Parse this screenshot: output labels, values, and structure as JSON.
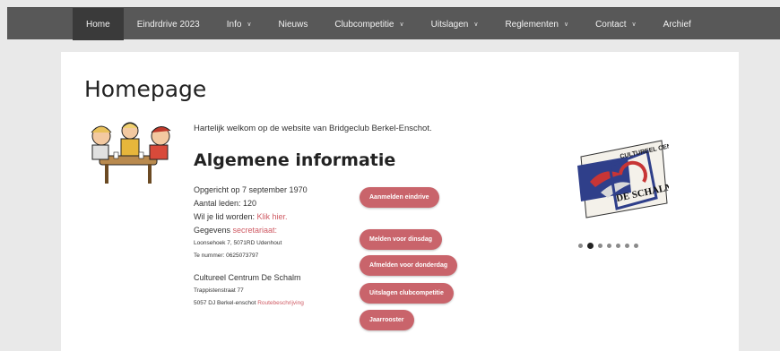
{
  "nav": {
    "items": [
      {
        "label": "Home",
        "dropdown": false,
        "active": true
      },
      {
        "label": "Eindrdrive 2023",
        "dropdown": false,
        "active": false
      },
      {
        "label": "Info",
        "dropdown": true,
        "active": false
      },
      {
        "label": "Nieuws",
        "dropdown": false,
        "active": false
      },
      {
        "label": "Clubcompetitie",
        "dropdown": true,
        "active": false
      },
      {
        "label": "Uitslagen",
        "dropdown": true,
        "active": false
      },
      {
        "label": "Reglementen",
        "dropdown": true,
        "active": false
      },
      {
        "label": "Contact",
        "dropdown": true,
        "active": false
      },
      {
        "label": "Archief",
        "dropdown": false,
        "active": false
      }
    ],
    "caret_glyph": "∨"
  },
  "page": {
    "title": "Homepage",
    "welcome": "Hartelijk welkom op de website van Bridgeclub Berkel-Enschot.",
    "section_title": "Algemene informatie"
  },
  "info": {
    "founded": "Opgericht op 7 september 1970",
    "members": "Aantal leden: 120",
    "join_prefix": "Wil je lid worden: ",
    "join_link": "Klik hier.",
    "contact_prefix": "Gegevens ",
    "contact_link": "secretariaat:",
    "address": "Loonsehoek 7, 5071RD Udenhout",
    "phone": "Te nummer: 0625073797",
    "venue_name": "Cultureel Centrum De Schalm",
    "venue_street": "Trappistenstraat 77",
    "venue_city": "5057 DJ Berkel-enschot ",
    "venue_link": "Routebeschrijving"
  },
  "buttons": {
    "eindrive": "Aanmelden eindrive",
    "melden_dinsdag": "Melden voor dinsdag",
    "afmelden_donderdag": "Afmelden voor donderdag",
    "uitslagen": "Uitslagen clubcompetitie",
    "jaarrooster": "Jaarrooster"
  },
  "logo": {
    "top_text": "CULTUREEL CENTRUM",
    "main_text": "DE SCHALM",
    "icon": "de-schalm-logo"
  },
  "carousel": {
    "count": 7,
    "active_index": 1
  },
  "colors": {
    "nav_bg": "#585858",
    "nav_active": "#3a3a3a",
    "accent": "#c9646b",
    "link": "#cf5a63",
    "page_bg": "#e9e9e9"
  }
}
